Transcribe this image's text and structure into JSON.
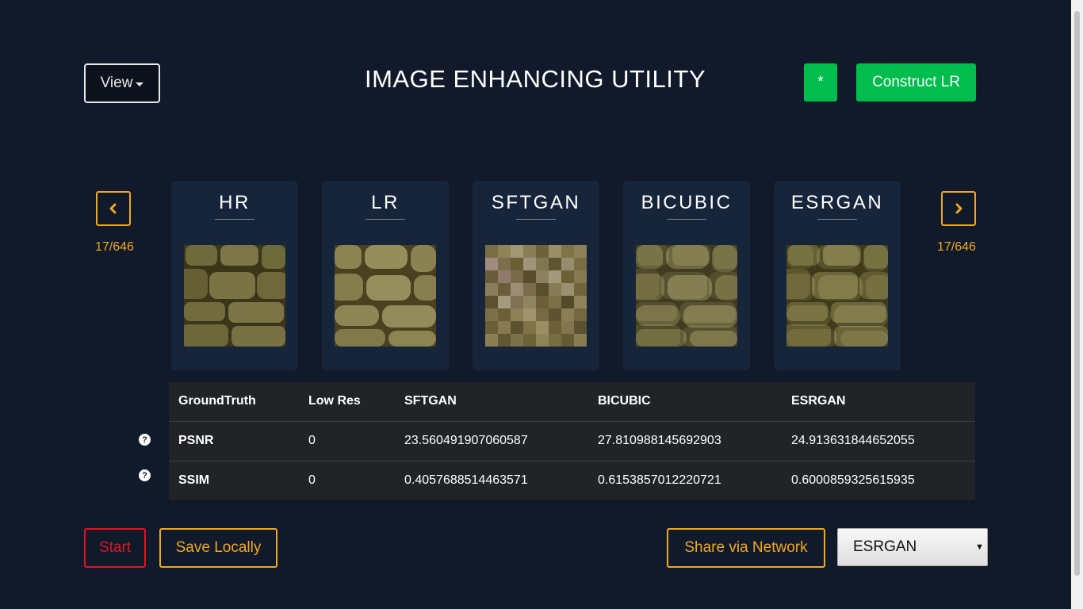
{
  "header": {
    "view_label": "View",
    "title": "IMAGE ENHANCING UTILITY",
    "star_label": "*",
    "construct_label": "Construct LR"
  },
  "gallery": {
    "counter_left": "17/646",
    "counter_right": "17/646",
    "cards": [
      {
        "title": "HR"
      },
      {
        "title": "LR"
      },
      {
        "title": "SFTGAN"
      },
      {
        "title": "BICUBIC"
      },
      {
        "title": "ESRGAN"
      }
    ]
  },
  "metrics": {
    "headers": [
      "GroundTruth",
      "Low Res",
      "SFTGAN",
      "BICUBIC",
      "ESRGAN"
    ],
    "rows": [
      {
        "name": "PSNR",
        "values": [
          "0",
          "23.560491907060587",
          "27.810988145692903",
          "24.913631844652055"
        ]
      },
      {
        "name": "SSIM",
        "values": [
          "0",
          "0.4057688514463571",
          "0.6153857012220721",
          "0.6000859325615935"
        ]
      }
    ],
    "help_glyph": "?"
  },
  "footer": {
    "start_label": "Start",
    "save_label": "Save Locally",
    "share_label": "Share via Network",
    "model_selected": "ESRGAN"
  },
  "colors": {
    "background": "#111a2b",
    "accent_green": "#00bd4d",
    "accent_orange": "#f0a81e",
    "danger_red": "#e0141e"
  }
}
